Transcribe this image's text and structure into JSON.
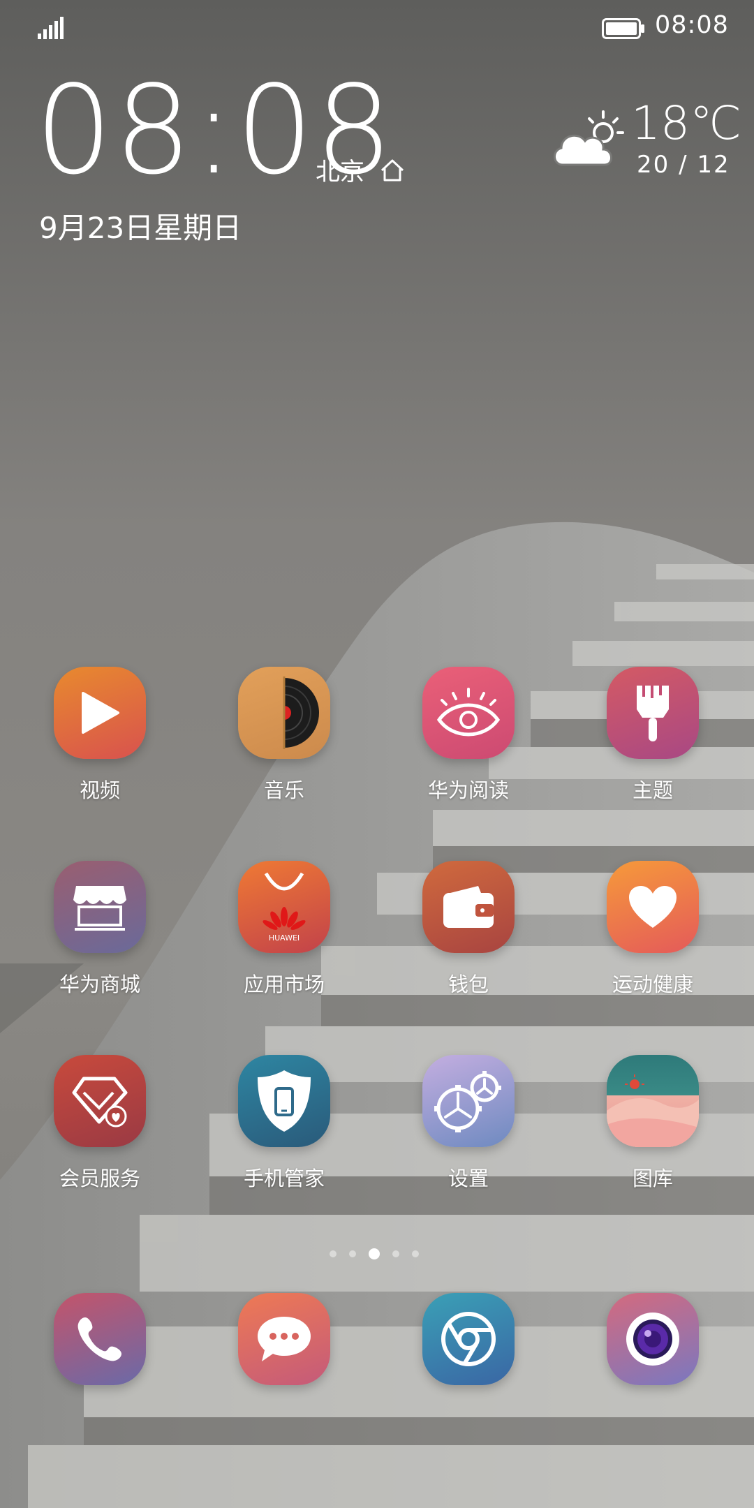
{
  "status_bar": {
    "time": "08:08",
    "battery_icon": "battery-icon",
    "signal_icon": "signal-icon"
  },
  "clock_widget": {
    "time": "08:08",
    "city": "北京",
    "date": "9月23日星期日",
    "home_icon": "home-icon"
  },
  "weather_widget": {
    "icon": "partly-cloudy-icon",
    "temperature": "18℃",
    "range": "20 / 12"
  },
  "apps": [
    {
      "label": "视频",
      "icon": "play-icon"
    },
    {
      "label": "音乐",
      "icon": "vinyl-icon"
    },
    {
      "label": "华为阅读",
      "icon": "eye-icon"
    },
    {
      "label": "主题",
      "icon": "paintbrush-icon"
    },
    {
      "label": "华为商城",
      "icon": "store-icon"
    },
    {
      "label": "应用市场",
      "icon": "shopping-bag-icon",
      "badge_text": "HUAWEI"
    },
    {
      "label": "钱包",
      "icon": "wallet-icon"
    },
    {
      "label": "运动健康",
      "icon": "heart-icon"
    },
    {
      "label": "会员服务",
      "icon": "diamond-icon"
    },
    {
      "label": "手机管家",
      "icon": "shield-phone-icon"
    },
    {
      "label": "设置",
      "icon": "gears-icon"
    },
    {
      "label": "图库",
      "icon": "landscape-icon"
    }
  ],
  "dock": [
    {
      "icon": "phone-icon"
    },
    {
      "icon": "message-bubble-icon"
    },
    {
      "icon": "browser-icon"
    },
    {
      "icon": "camera-icon"
    }
  ],
  "page_indicator": {
    "pages": 5,
    "active_index": 2
  },
  "colors": {
    "video": "#e0683a",
    "music": "#d99a55",
    "reader": "#e0577a",
    "themes": "#c74c72",
    "store": "#8a6a84",
    "appmarket": "#e27a3a",
    "wallet": "#c4583a",
    "health": "#f08448",
    "vip": "#b9423c",
    "phonemanager": "#3a6e8c",
    "settings": "#9a92c0",
    "gallery": "#e8a8a0",
    "phone": "#a86a8a",
    "messages": "#e07868",
    "browser": "#3a80b0",
    "camera": "#a880b8"
  }
}
